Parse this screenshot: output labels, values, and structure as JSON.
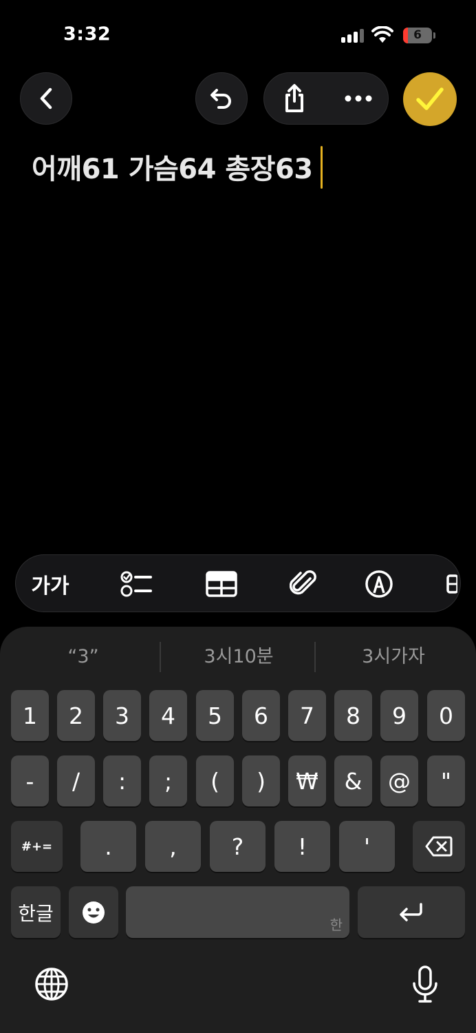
{
  "status_bar": {
    "time": "3:32",
    "battery_level": "6"
  },
  "toolbar": {
    "back_icon": "chevron-left-icon",
    "undo_icon": "undo-icon",
    "share_icon": "share-icon",
    "more_icon": "ellipsis-icon",
    "done_icon": "checkmark-icon",
    "accent_color": "#d4a62a"
  },
  "note": {
    "text": "어깨61 가슴64 총장63"
  },
  "format_bar": {
    "text_style_label": "가가",
    "items": [
      "checklist-icon",
      "table-icon",
      "paperclip-icon",
      "markup-pen-icon",
      "more-format-icon"
    ]
  },
  "keyboard": {
    "suggestions": [
      "“3”",
      "3시10분",
      "3시가자"
    ],
    "row1": [
      "1",
      "2",
      "3",
      "4",
      "5",
      "6",
      "7",
      "8",
      "9",
      "0"
    ],
    "row2": [
      "-",
      "/",
      ":",
      ";",
      "(",
      ")",
      "₩",
      "&",
      "@",
      "\""
    ],
    "row3": {
      "symbols_toggle": "#+=",
      "keys": [
        ".",
        ",",
        "?",
        "!",
        "'"
      ],
      "delete_icon": "backspace-icon"
    },
    "row4": {
      "language_key": "한글",
      "emoji_icon": "emoji-icon",
      "space_hint": "한",
      "return_icon": "return-icon"
    },
    "globe_icon": "globe-icon",
    "mic_icon": "microphone-icon"
  }
}
